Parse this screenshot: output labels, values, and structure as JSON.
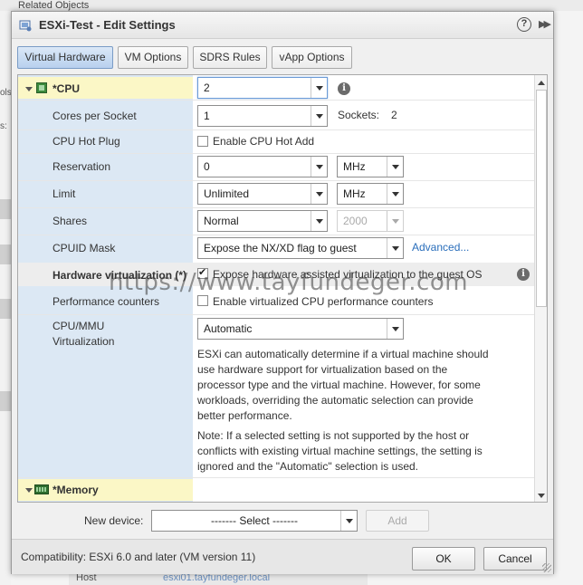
{
  "background": {
    "top_text": "Related Objects",
    "left_text_1": "ols",
    "left_text_2": "s:",
    "bottom_label": "Host",
    "bottom_value": "esxi01.tayfundeger.local"
  },
  "dialog": {
    "title": "ESXi-Test - Edit Settings",
    "help": "?",
    "expand": "▶▶"
  },
  "tabs": [
    {
      "label": "Virtual Hardware"
    },
    {
      "label": "VM Options"
    },
    {
      "label": "SDRS Rules"
    },
    {
      "label": "vApp Options"
    }
  ],
  "cpu": {
    "header": "*CPU",
    "value": "2",
    "cores_label": "Cores per Socket",
    "cores_value": "1",
    "sockets_label": "Sockets:",
    "sockets_value": "2",
    "hotplug_label": "CPU Hot Plug",
    "hotplug_checkbox": "Enable CPU Hot Add",
    "reservation_label": "Reservation",
    "reservation_value": "0",
    "reservation_unit": "MHz",
    "limit_label": "Limit",
    "limit_value": "Unlimited",
    "limit_unit": "MHz",
    "shares_label": "Shares",
    "shares_value": "Normal",
    "shares_number": "2000",
    "cpuid_label": "CPUID Mask",
    "cpuid_value": "Expose the NX/XD flag to guest",
    "advanced_link": "Advanced...",
    "hv_label": "Hardware virtualization (*)",
    "hv_checkbox": "Expose hardware assisted virtualization to the guest OS",
    "perf_label": "Performance counters",
    "perf_checkbox": "Enable virtualized CPU performance counters",
    "mmu_label_1": "CPU/MMU",
    "mmu_label_2": "Virtualization",
    "mmu_value": "Automatic",
    "desc_lines": [
      "ESXi can automatically determine if a virtual machine should",
      "use hardware support for virtualization based on the",
      "processor type and the virtual machine. However, for some",
      "workloads, overriding the automatic selection can provide",
      "better performance."
    ],
    "note_lines": [
      "Note: If a selected setting is not supported by the host or",
      "conflicts with existing virtual machine settings, the setting is",
      "ignored and the \"Automatic\" selection is used."
    ]
  },
  "memory": {
    "header": "*Memory"
  },
  "watermark": "https://www.tayfundeger.com",
  "new_device": {
    "label": "New device:",
    "select": "------- Select -------",
    "add": "Add"
  },
  "footer": {
    "compatibility": "Compatibility: ESXi 6.0 and later (VM version 11)",
    "ok": "OK",
    "cancel": "Cancel"
  },
  "colors": {
    "label_column": "#dce8f4",
    "section_header": "#fbf7c6",
    "active_tab": "#b8d0ee",
    "link": "#2a6ebb"
  }
}
